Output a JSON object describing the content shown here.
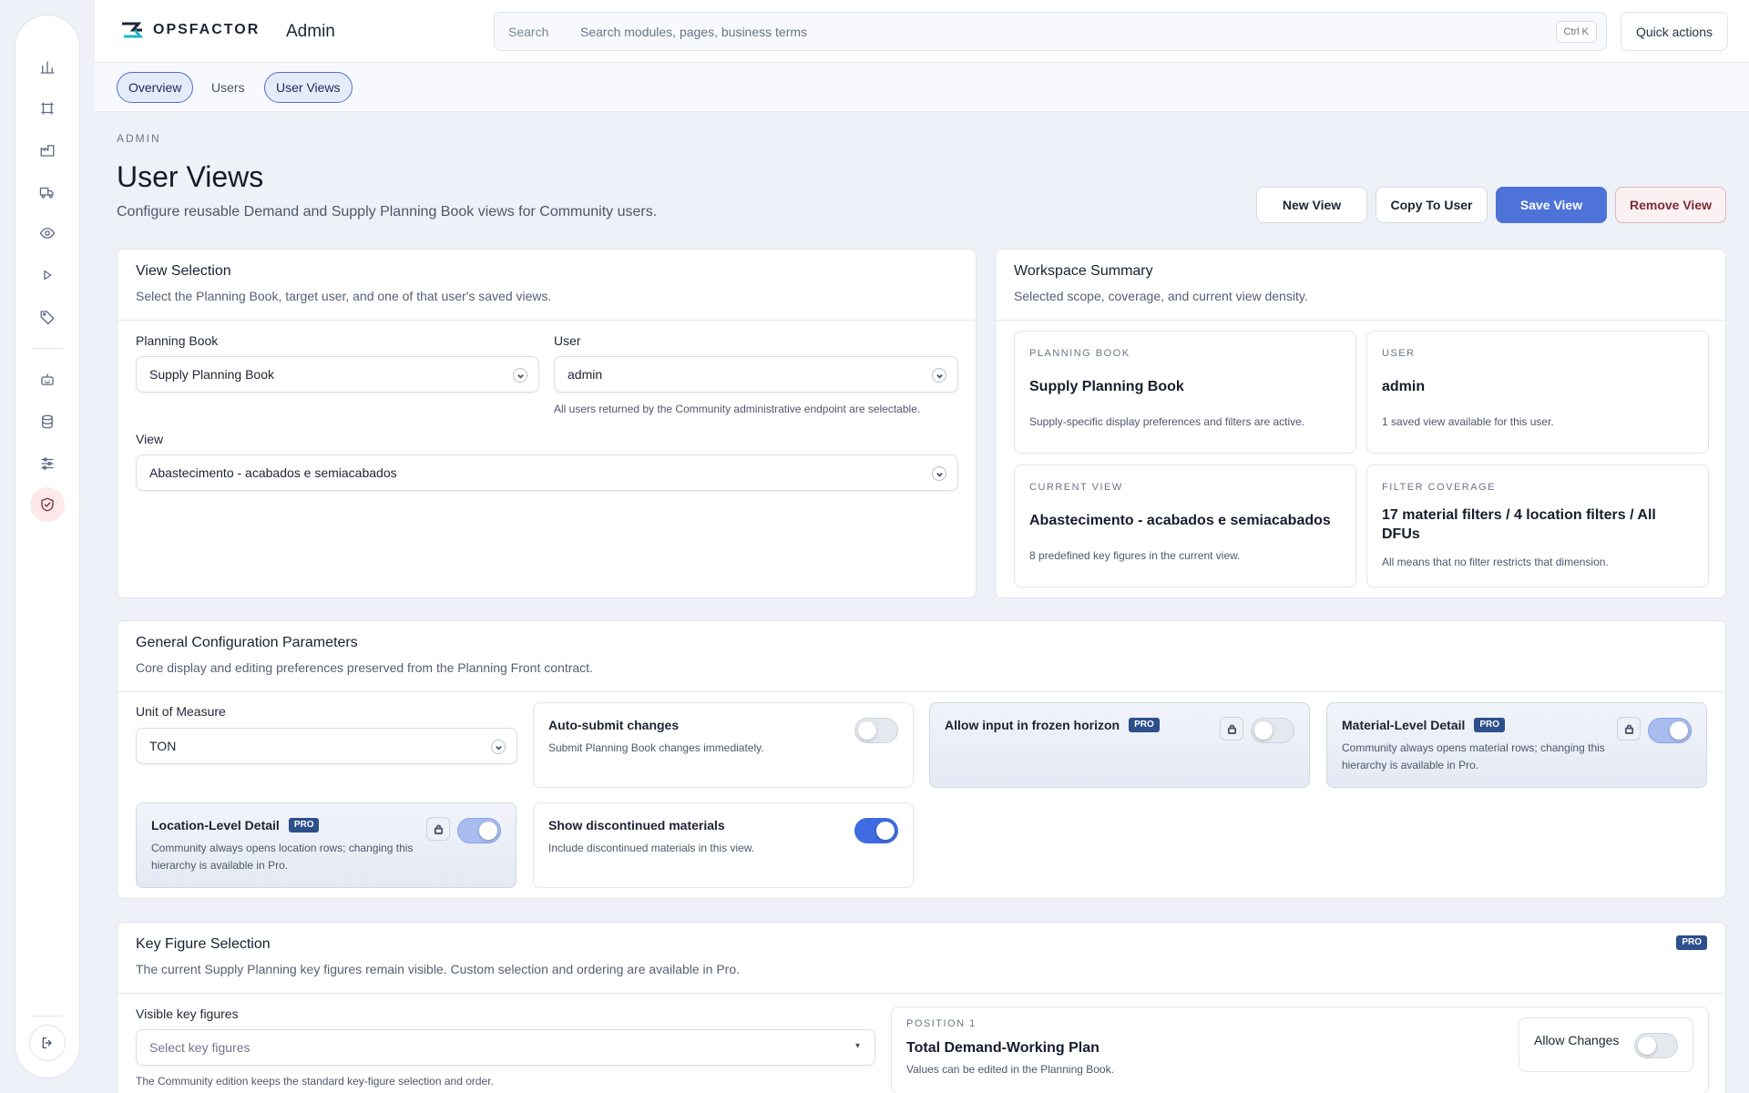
{
  "app": {
    "logo_text": "OPSFACTOR",
    "section_title": "Admin",
    "search_label": "Search",
    "search_placeholder": "Search modules, pages, business terms",
    "search_shortcut": "Ctrl K",
    "quick_actions": "Quick actions"
  },
  "rail": {
    "items": [
      "chart-icon",
      "workflow-icon",
      "factory-icon",
      "truck-icon",
      "eye-icon",
      "play-icon",
      "tag-icon",
      "robot-icon",
      "database-icon",
      "sliders-icon",
      "shield-check-icon"
    ],
    "active": "shield-check-icon",
    "logout_icon": "logout-icon"
  },
  "tabs": [
    {
      "label": "Overview",
      "active": true
    },
    {
      "label": "Users",
      "active": false
    },
    {
      "label": "User Views",
      "active": true
    }
  ],
  "header": {
    "eyebrow": "ADMIN",
    "title": "User Views",
    "subtitle": "Configure reusable Demand and Supply Planning Book views for Community users.",
    "actions": {
      "new_view": "New View",
      "copy_to_user": "Copy To User",
      "save_view": "Save View",
      "remove_view": "Remove View"
    }
  },
  "view_selection": {
    "title": "View Selection",
    "subtitle": "Select the Planning Book, target user, and one of that user's saved views.",
    "planning_book_label": "Planning Book",
    "planning_book_value": "Supply Planning Book",
    "user_label": "User",
    "user_value": "admin",
    "user_hint": "All users returned by the Community administrative endpoint are selectable.",
    "view_label": "View",
    "view_value": "Abastecimento - acabados e semiacabados"
  },
  "workspace_summary": {
    "title": "Workspace Summary",
    "subtitle": "Selected scope, coverage, and current view density.",
    "cards": [
      {
        "eyebrow": "PLANNING BOOK",
        "value": "Supply Planning Book",
        "desc": "Supply-specific display preferences and filters are active."
      },
      {
        "eyebrow": "USER",
        "value": "admin",
        "desc": "1 saved view available for this user."
      },
      {
        "eyebrow": "CURRENT VIEW",
        "value": "Abastecimento - acabados e semiacabados",
        "desc": "8 predefined key figures in the current view."
      },
      {
        "eyebrow": "FILTER COVERAGE",
        "value": "17 material filters / 4 location filters / All DFUs",
        "desc": "All means that no filter restricts that dimension."
      }
    ]
  },
  "general_config": {
    "title": "General Configuration Parameters",
    "subtitle": "Core display and editing preferences preserved from the Planning Front contract.",
    "unit_label": "Unit of Measure",
    "unit_value": "TON",
    "pro_badge": "PRO",
    "toggles": [
      {
        "title": "Auto-submit changes",
        "desc": "Submit Planning Book changes immediately.",
        "on": false,
        "pro": false
      },
      {
        "title": "Allow input in frozen horizon",
        "desc": "",
        "on": false,
        "pro": true
      },
      {
        "title": "Material-Level Detail",
        "desc": "Community always opens material rows; changing this hierarchy is available in Pro.",
        "on": true,
        "pro": true
      },
      {
        "title": "Location-Level Detail",
        "desc": "Community always opens location rows; changing this hierarchy is available in Pro.",
        "on": true,
        "pro": true
      },
      {
        "title": "Show discontinued materials",
        "desc": "Include discontinued materials in this view.",
        "on": true,
        "pro": false
      }
    ]
  },
  "key_figures": {
    "title": "Key Figure Selection",
    "pro_badge": "PRO",
    "subtitle": "The current Supply Planning key figures remain visible. Custom selection and ordering are available in Pro.",
    "visible_label": "Visible key figures",
    "visible_placeholder": "Select key figures",
    "visible_hint": "The Community edition keeps the standard key-figure selection and order.",
    "position_eyebrow": "POSITION 1",
    "position_title": "Total Demand-Working Plan",
    "position_desc": "Values can be edited in the Planning Book.",
    "allow_changes_label": "Allow Changes",
    "allow_changes_on": false
  },
  "colors": {
    "primary": "#4d72d8",
    "danger_text": "#7d2a38",
    "pro_badge": "#2d4f8c",
    "toggle_on": "#3f6be0",
    "active_rail": "#fde8ec"
  }
}
